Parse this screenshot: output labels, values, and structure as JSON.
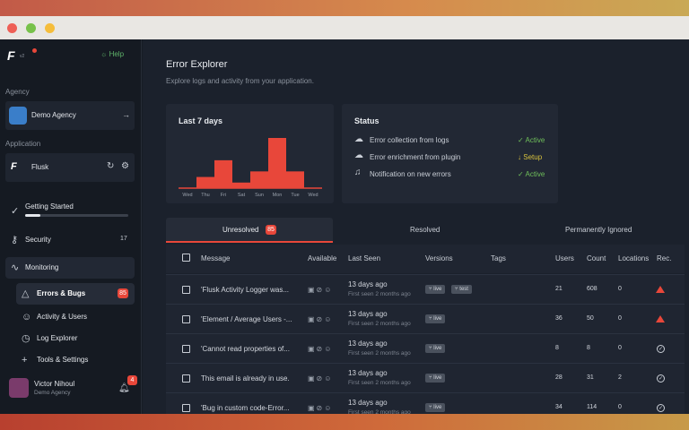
{
  "sidebar": {
    "help_label": "Help",
    "agency_section": "Agency",
    "agency_name": "Demo Agency",
    "application_section": "Application",
    "app_name": "Flusk",
    "getting_started": "Getting Started",
    "getting_started_progress": 0.15,
    "security": "Security",
    "security_count": "17",
    "monitoring": "Monitoring",
    "errors_bugs": "Errors & Bugs",
    "errors_count": "85",
    "activity_users": "Activity & Users",
    "log_explorer": "Log Explorer",
    "tools_settings": "Tools & Settings",
    "user_name": "Victor Nihoul",
    "user_org": "Demo Agency",
    "notif_count": "4"
  },
  "page": {
    "title": "Error Explorer",
    "subtitle": "Explore logs and activity from your application."
  },
  "last7": {
    "title": "Last 7 days"
  },
  "chart_data": {
    "type": "bar",
    "categories": [
      "Wed",
      "Thu",
      "Fri",
      "Sat",
      "Sun",
      "Mon",
      "Tue",
      "Wed"
    ],
    "values": [
      0,
      2,
      5,
      1,
      3,
      9,
      3,
      0
    ],
    "title": "Last 7 days",
    "xlabel": "",
    "ylabel": "",
    "color": "#e8473a"
  },
  "status": {
    "title": "Status",
    "items": [
      {
        "label": "Error collection from logs",
        "state": "Active",
        "icon": "cloud-upload-icon",
        "color": "#6fbf5a"
      },
      {
        "label": "Error enrichment from plugin",
        "state": "Setup",
        "icon": "cloud-upload-icon",
        "color": "#d9c33d"
      },
      {
        "label": "Notification on new errors",
        "state": "Active",
        "icon": "bell-icon",
        "color": "#6fbf5a"
      }
    ]
  },
  "tabs": {
    "unresolved": "Unresolved",
    "unresolved_count": "85",
    "resolved": "Resolved",
    "ignored": "Permanently Ignored"
  },
  "table": {
    "headers": [
      "Message",
      "Available",
      "Last Seen",
      "Versions",
      "Tags",
      "Users",
      "Count",
      "Locations",
      "Rec."
    ],
    "rows": [
      {
        "message": "'Flusk Activity Logger was...",
        "last_seen": "13 days ago",
        "first_seen": "First seen 2 months ago",
        "versions": [
          "live",
          "test"
        ],
        "users": "21",
        "count": "608",
        "locations": "0",
        "rec": "warning"
      },
      {
        "message": "'Element / Average Users -...",
        "last_seen": "13 days ago",
        "first_seen": "First seen 2 months ago",
        "versions": [
          "live"
        ],
        "users": "36",
        "count": "50",
        "locations": "0",
        "rec": "warning"
      },
      {
        "message": "'Cannot read properties of...",
        "last_seen": "13 days ago",
        "first_seen": "First seen 2 months ago",
        "versions": [
          "live"
        ],
        "users": "8",
        "count": "8",
        "locations": "0",
        "rec": "ok"
      },
      {
        "message": "This email is already in use.",
        "last_seen": "13 days ago",
        "first_seen": "First seen 2 months ago",
        "versions": [
          "live"
        ],
        "users": "28",
        "count": "31",
        "locations": "2",
        "rec": "ok"
      },
      {
        "message": "'Bug in custom code-Error...",
        "last_seen": "13 days ago",
        "first_seen": "First seen 2 months ago",
        "versions": [
          "live"
        ],
        "users": "34",
        "count": "114",
        "locations": "0",
        "rec": "ok"
      }
    ]
  }
}
